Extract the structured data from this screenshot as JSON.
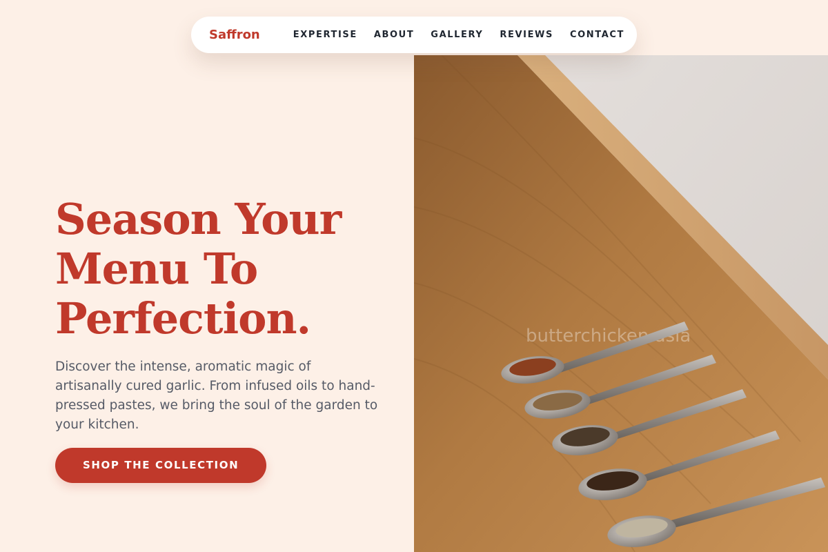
{
  "nav": {
    "brand": "Saffron",
    "links": [
      "EXPERTISE",
      "ABOUT",
      "GALLERY",
      "REVIEWS",
      "CONTACT"
    ]
  },
  "hero": {
    "title_lines": [
      "Season Your",
      "Menu To",
      "Perfection."
    ],
    "description": "Discover the intense, aromatic magic of artisanally cured garlic. From infused oils to hand-pressed pastes, we bring the soul of the garden to your kitchen.",
    "cta_label": "SHOP THE COLLECTION"
  },
  "image": {
    "subject": "spice-spoons-on-wooden-board",
    "watermark": "butterchicken.asia"
  },
  "colors": {
    "background": "#fdf0e7",
    "accent": "#c0392b",
    "nav_text": "#1f2630",
    "body_text": "#555a66"
  }
}
